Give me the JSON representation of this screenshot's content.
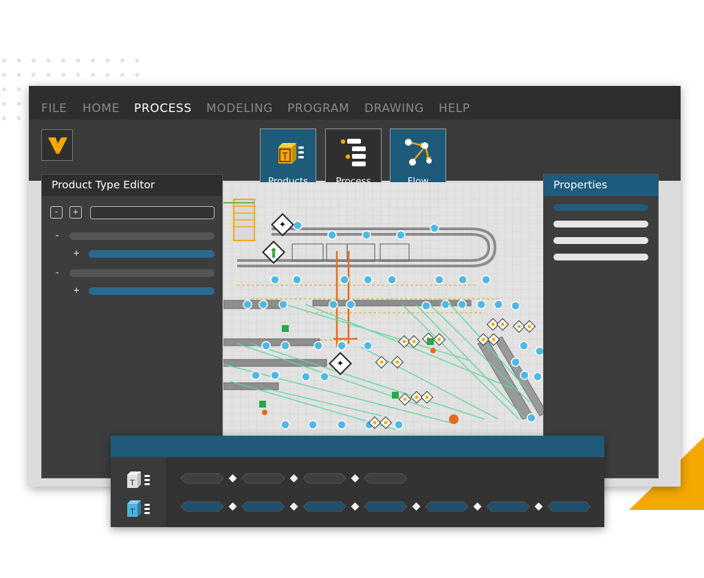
{
  "menu": {
    "items": [
      {
        "label": "FILE",
        "active": false
      },
      {
        "label": "HOME",
        "active": false
      },
      {
        "label": "PROCESS",
        "active": true
      },
      {
        "label": "MODELING",
        "active": false
      },
      {
        "label": "PROGRAM",
        "active": false
      },
      {
        "label": "DRAWING",
        "active": false
      },
      {
        "label": "HELP",
        "active": false
      }
    ]
  },
  "ribbon": {
    "products_label": "Products",
    "process_label": "Process",
    "flow_label": "Flow"
  },
  "product_type_editor": {
    "title": "Product Type Editor",
    "collapse_symbol": "-",
    "expand_symbol": "+",
    "tree": [
      {
        "sign": "-",
        "level": 0,
        "style": "gray"
      },
      {
        "sign": "+",
        "level": 1,
        "style": "blue"
      },
      {
        "sign": "-",
        "level": 0,
        "style": "gray"
      },
      {
        "sign": "+",
        "level": 1,
        "style": "blue"
      }
    ]
  },
  "properties": {
    "title": "Properties",
    "rows": [
      "selected",
      "field",
      "field",
      "field"
    ]
  },
  "timeline": {
    "tracks": [
      {
        "icon": "product-type-gray-icon",
        "segments": 4
      },
      {
        "icon": "product-type-blue-icon",
        "segments": 7
      }
    ]
  },
  "colors": {
    "accent": "#f5a800",
    "primary_blue": "#1f5b7c",
    "panel_dark": "#3d3d3d",
    "flow_green": "#5fd6a0",
    "node_blue": "#4fb8e6",
    "warning_orange": "#f5a800"
  }
}
